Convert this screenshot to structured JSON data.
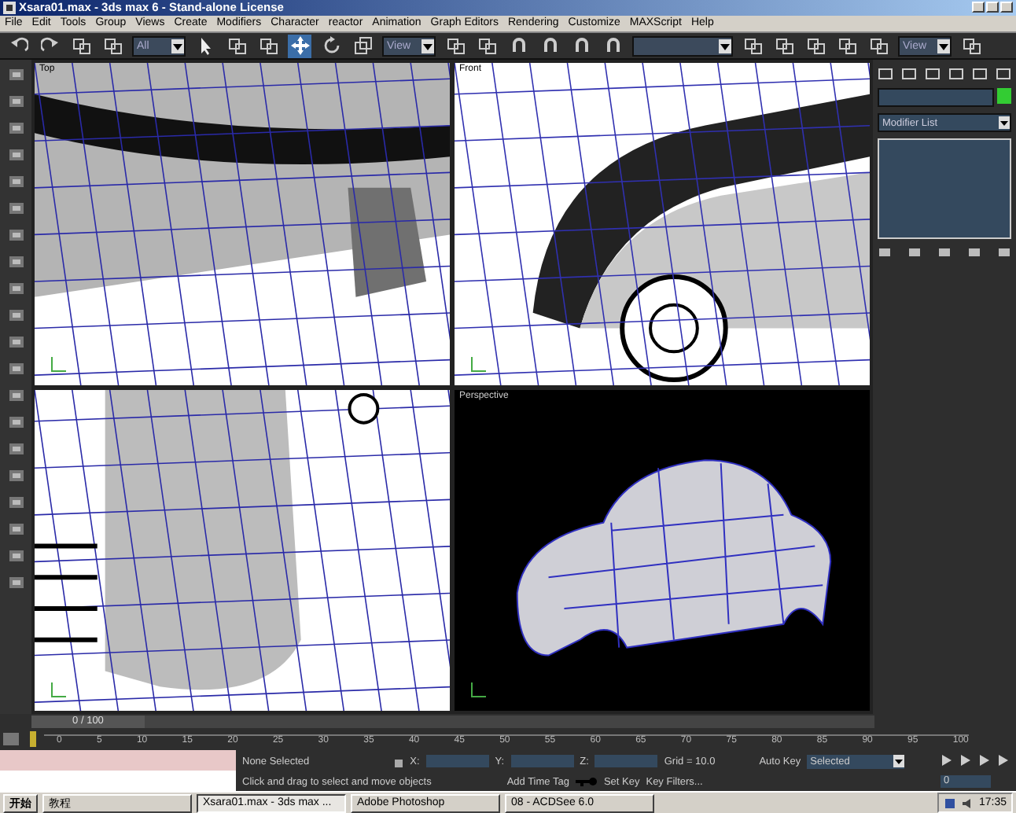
{
  "window": {
    "title": "Xsara01.max - 3ds max 6 - Stand-alone License"
  },
  "menu": [
    "File",
    "Edit",
    "Tools",
    "Group",
    "Views",
    "Create",
    "Modifiers",
    "Character",
    "reactor",
    "Animation",
    "Graph Editors",
    "Rendering",
    "Customize",
    "MAXScript",
    "Help"
  ],
  "toolbar": [
    {
      "kind": "undo",
      "selected": false
    },
    {
      "kind": "redo",
      "selected": false
    },
    {
      "kind": "link",
      "selected": false
    },
    {
      "kind": "link",
      "selected": false
    },
    {
      "kind": "dropdown",
      "value": "All"
    },
    {
      "kind": "select",
      "selected": false
    },
    {
      "kind": "link",
      "selected": false
    },
    {
      "kind": "link",
      "selected": false
    },
    {
      "kind": "move",
      "selected": true
    },
    {
      "kind": "rotate",
      "selected": false
    },
    {
      "kind": "scale",
      "selected": false
    },
    {
      "kind": "dropdown",
      "value": "View"
    },
    {
      "kind": "link",
      "selected": false
    },
    {
      "kind": "link",
      "selected": false
    },
    {
      "kind": "magnet",
      "selected": false
    },
    {
      "kind": "magnet",
      "selected": false
    },
    {
      "kind": "magnet",
      "selected": false
    },
    {
      "kind": "magnet",
      "selected": false
    },
    {
      "kind": "dropdown"
    },
    {
      "kind": "link",
      "selected": false
    },
    {
      "kind": "link",
      "selected": false
    },
    {
      "kind": "link",
      "selected": false
    },
    {
      "kind": "link",
      "selected": false
    },
    {
      "kind": "link",
      "selected": false
    },
    {
      "kind": "dropdown",
      "value": "View"
    },
    {
      "kind": "link",
      "selected": false
    }
  ],
  "viewports": [
    {
      "label": "Top",
      "kind": "top"
    },
    {
      "label": "Front",
      "kind": "front"
    },
    {
      "kind": "left"
    },
    {
      "label": "Perspective",
      "kind": "perspective"
    }
  ],
  "command_panel": {
    "modifier_list": "Modifier List"
  },
  "timeline": {
    "frame": "0 / 100",
    "level": 0,
    "ticks": [
      "0",
      "5",
      "10",
      "15",
      "20",
      "25",
      "30",
      "35",
      "40",
      "45",
      "50",
      "55",
      "60",
      "65",
      "70",
      "75",
      "80",
      "85",
      "90",
      "95",
      "100"
    ]
  },
  "status": {
    "selection": "None Selected",
    "x_label": "X:",
    "y_label": "Y:",
    "z_label": "Z:",
    "grid": "Grid = 10.0",
    "prompt": "Click and drag to select and move objects",
    "time_tag": "Add Time Tag",
    "auto_key": "Auto Key",
    "key_mode": "Selected",
    "set_key": "Set Key",
    "key_filters": "Key Filters...",
    "frame": "0"
  },
  "taskbar": {
    "start": "开始",
    "buttons": [
      {
        "label": "教程",
        "selected": false
      },
      {
        "label": "Xsara01.max - 3ds max ...",
        "selected": true
      },
      {
        "label": "Adobe Photoshop",
        "selected": false
      },
      {
        "label": "08 - ACDSee 6.0",
        "selected": false
      }
    ],
    "clock": "17:35"
  }
}
